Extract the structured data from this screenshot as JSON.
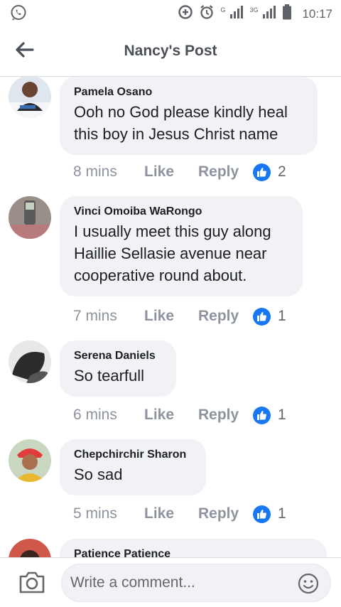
{
  "status_bar": {
    "time": "10:17",
    "net1": "G",
    "net2": "3G",
    "icons": [
      "whatsapp-icon",
      "data-saver-icon",
      "alarm-icon",
      "signal-icon",
      "battery-icon"
    ]
  },
  "header": {
    "title": "Nancy's Post",
    "back_icon": "arrow-left-icon"
  },
  "comments": [
    {
      "author": "Pamela Osano",
      "text": "Ooh no God please kindly heal this boy in Jesus Christ name",
      "time": "8 mins",
      "like_label": "Like",
      "reply_label": "Reply",
      "reaction_count": "2"
    },
    {
      "author": "Vinci Omoiba WaRongo",
      "text": "I usually meet this guy along Haillie Sellasie avenue near cooperative round about.",
      "time": "7 mins",
      "like_label": "Like",
      "reply_label": "Reply",
      "reaction_count": "1"
    },
    {
      "author": "Serena Daniels",
      "text": "So tearfull",
      "time": "6 mins",
      "like_label": "Like",
      "reply_label": "Reply",
      "reaction_count": "1"
    },
    {
      "author": "Chepchirchir Sharon",
      "text": "So sad",
      "time": "5 mins",
      "like_label": "Like",
      "reply_label": "Reply",
      "reaction_count": "1"
    },
    {
      "author": "Patience Patience",
      "text": ""
    }
  ],
  "composer": {
    "placeholder": "Write a comment...",
    "camera_icon": "camera-icon",
    "emoji_icon": "emoji-icon"
  },
  "colors": {
    "bubble": "#f0f2f5",
    "like_blue": "#1877f2",
    "meta_gray": "#8d949e"
  }
}
